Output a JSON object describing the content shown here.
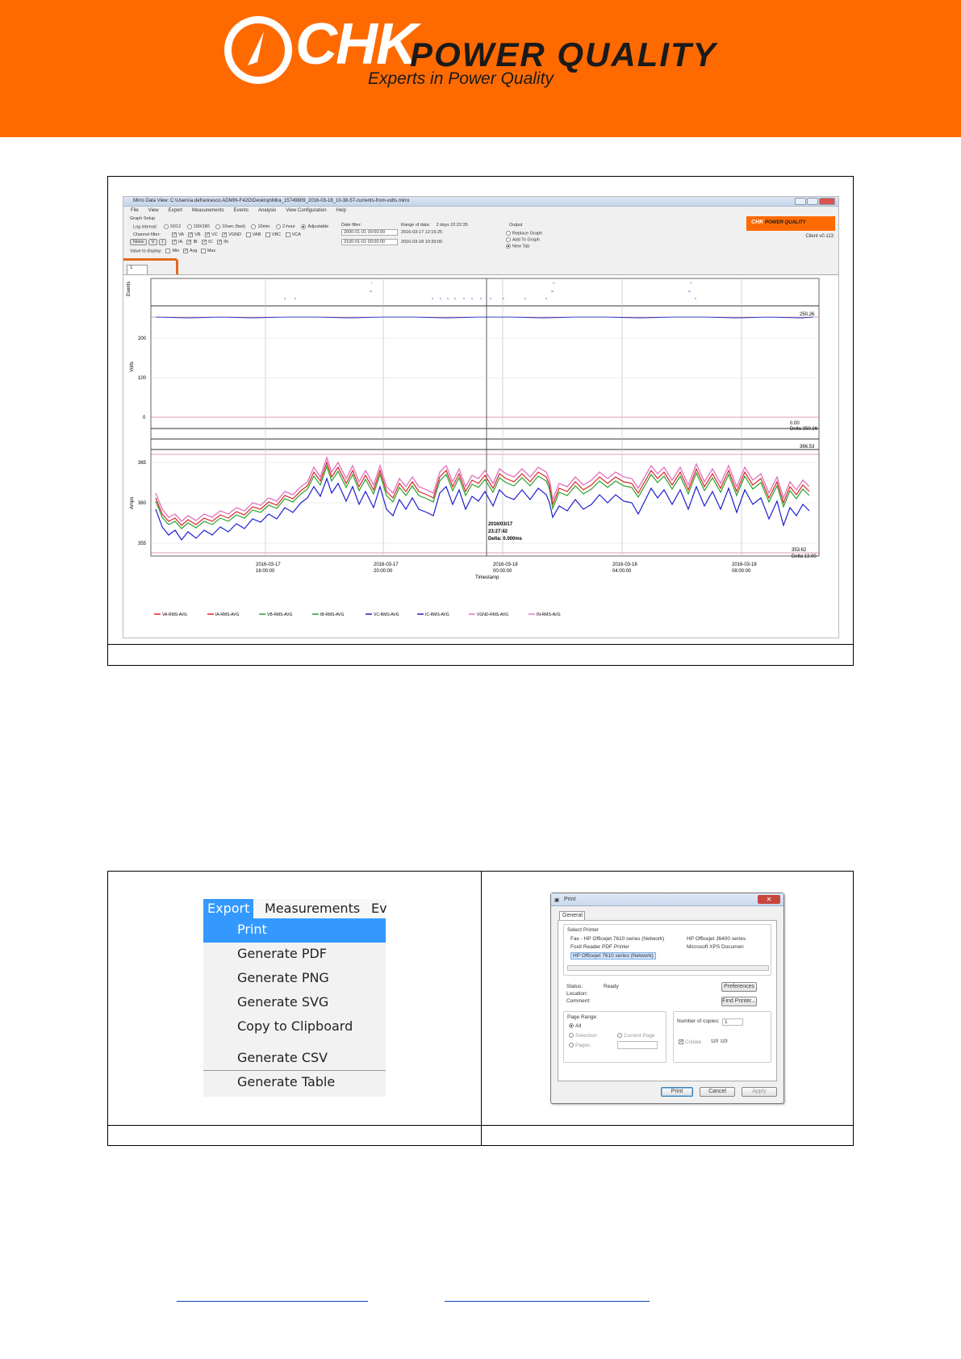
{
  "header": {
    "logo_main": "CHK",
    "logo_sub": "POWER QUALITY",
    "tagline": "Experts in Power Quality",
    "bg_color": "#ff6a00"
  },
  "figure1": {
    "caption": "",
    "app": {
      "title": "Mirro Data View: C:\\Users\\a.defrancesco.ADMIN-F42O\\Desktop\\Mira_15749809_2016-03-18_10-38-57-currents-from-volts.mirro",
      "menu": [
        "File",
        "View",
        "Export",
        "Measurements",
        "Events",
        "Analysis",
        "View Configuration",
        "Help"
      ],
      "graph_setup": "Graph Setup",
      "log_interval_label": "Log interval:",
      "log_intervals": [
        "10/12",
        "150/180",
        "10sec (fast)",
        "10min",
        "2-hour",
        "Adjustable"
      ],
      "channel_filter_label": "Channel filter:",
      "channel_buttons": [
        "None",
        "V",
        "I"
      ],
      "channels_row1": [
        "VA",
        "VB",
        "VC",
        "VGND",
        "VAB",
        "VBC",
        "VCA"
      ],
      "channels_row2": [
        "IA",
        "IB",
        "IC",
        "IN"
      ],
      "value_display_label": "Value to display:",
      "value_display": [
        "Min",
        "Avg",
        "Max"
      ],
      "date_filter_label": "Date filter:",
      "date_from": "2000-01-01 00:00:00",
      "date_to": "2100-01-01 00:00:00",
      "range_label": "Range of data:",
      "range_value": "2 days 22:22:35",
      "range_start": "2016-03-17 12:16:25",
      "range_end": "2016-03-18 10:39:00",
      "output_label": "Output",
      "output_options": [
        "Replace Graph",
        "Add To Graph",
        "New Tab"
      ],
      "logo": "CHK",
      "logo_sub": "POWER QUALITY",
      "version": "Client v0.113",
      "tab_label": "1",
      "plot": {
        "events_label": "Events",
        "volts_label": "Volts",
        "amps_label": "Amps",
        "volts_ticks": [
          "200",
          "100",
          "0"
        ],
        "volts_top": "250.26",
        "volts_bottom": "0.00",
        "volts_delta": "Delta 250.26",
        "amps_ticks": [
          "365",
          "360",
          "355"
        ],
        "amps_top": "366.53",
        "amps_bottom": "353.62",
        "amps_delta": "Delta 13.00",
        "cursor_date": "2016/03/17",
        "cursor_time": "23:27:42",
        "cursor_delta": "Delta: 0.000ms",
        "x_ticks": [
          {
            "d": "2016-03-17",
            "t": "16:00:00"
          },
          {
            "d": "2016-03-17",
            "t": "20:00:00"
          },
          {
            "d": "2016-03-18",
            "t": "00:00:00"
          },
          {
            "d": "2016-03-18",
            "t": "04:00:00"
          },
          {
            "d": "2016-03-18",
            "t": "08:00:00"
          }
        ],
        "x_label": "Timestamp",
        "legend": [
          {
            "name": "VA-RMS-AVG",
            "color": "#d62728"
          },
          {
            "name": "IA-RMS-AVG",
            "color": "#d62728"
          },
          {
            "name": "VB-RMS-AVG",
            "color": "#2ca02c"
          },
          {
            "name": "IB-RMS-AVG",
            "color": "#2ca02c"
          },
          {
            "name": "VC-RMS-AVG",
            "color": "#1f1fd0"
          },
          {
            "name": "IC-RMS-AVG",
            "color": "#1f1fd0"
          },
          {
            "name": "VGND-RMS-AVG",
            "color": "#e377c2"
          },
          {
            "name": "IN-RMS-AVG",
            "color": "#e377c2"
          }
        ]
      }
    }
  },
  "figure2": {
    "menu": {
      "bar": [
        "Export",
        "Measurements",
        "Ev"
      ],
      "items": [
        "Print",
        "Generate PDF",
        "Generate PNG",
        "Generate SVG",
        "Copy to Clipboard",
        "Generate CSV",
        "Generate Table"
      ],
      "selected": "Print"
    },
    "print_dialog": {
      "title": "Print",
      "tab": "General",
      "select_printer": "Select Printer",
      "printers": [
        "Fax - HP Officejet 7610 series (Network)",
        "HP Officejet J6400 series",
        "Foxit Reader PDF Printer",
        "Microsoft XPS Documen",
        "HP Officejet 7610 series (Network)"
      ],
      "status_label": "Status:",
      "status_value": "Ready",
      "location_label": "Location:",
      "comment_label": "Comment:",
      "preferences": "Preferences",
      "find_printer": "Find Printer...",
      "page_range": "Page Range",
      "all": "All",
      "selection": "Selection",
      "current_page": "Current Page",
      "pages": "Pages:",
      "copies_label": "Number of copies:",
      "copies_value": "1",
      "collate": "Collate",
      "print_btn": "Print",
      "cancel_btn": "Cancel",
      "apply_btn": "Apply"
    },
    "captions": [
      "",
      ""
    ]
  }
}
